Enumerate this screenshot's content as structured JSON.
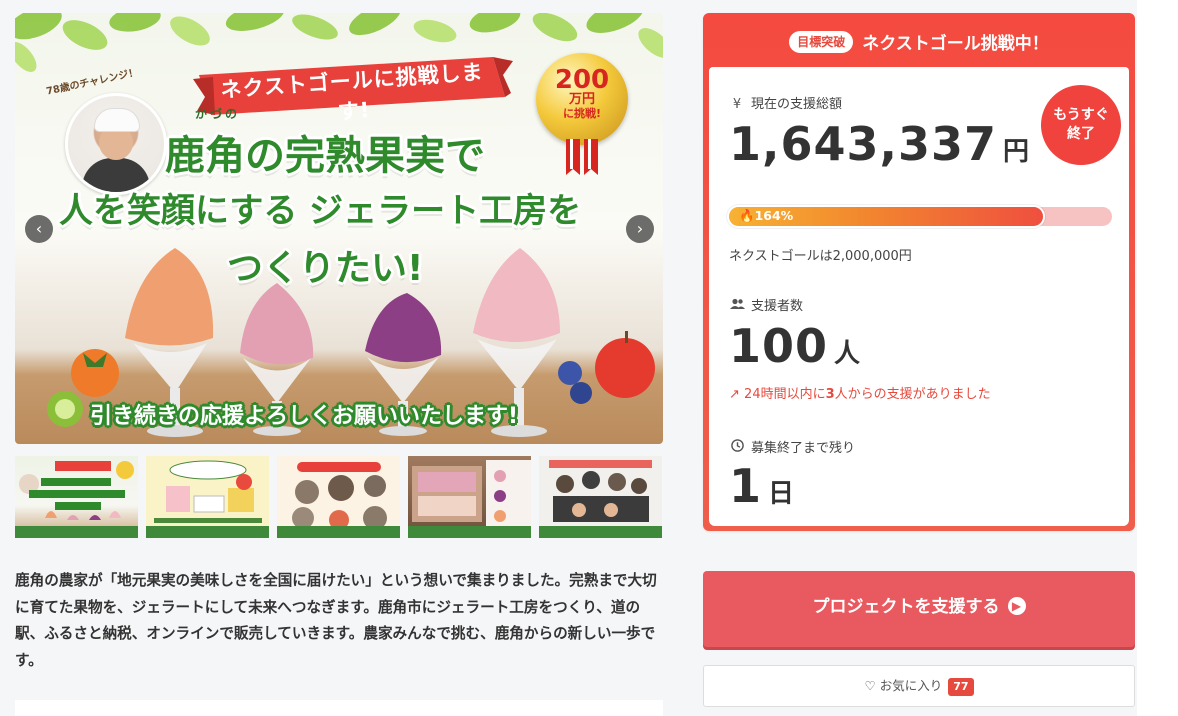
{
  "hero": {
    "banner": "ネクストゴールに挑戦します!",
    "badge_amount": "200",
    "badge_unit": "万円",
    "badge_challenge": "に挑戦!",
    "age_tag": "78歳のチャレンジ！",
    "furigana": "かづの",
    "title_line1": "鹿角の完熟果実で",
    "title_line2": "人を笑顔にする ジェラート工房を",
    "title_line3": "つくりたい!",
    "caption": "引き続きの応援よろしくお願いいたします!",
    "prev_icon": "chevron-left-icon",
    "next_icon": "chevron-right-icon"
  },
  "thumbnails": [
    {
      "name": "thumb-1"
    },
    {
      "name": "thumb-2"
    },
    {
      "name": "thumb-3"
    },
    {
      "name": "thumb-4"
    },
    {
      "name": "thumb-5"
    }
  ],
  "description": "鹿角の農家が「地元果実の美味しさを全国に届けたい」という想いで集まりました。完熟まで大切に育てた果物を、ジェラートにして未来へつなぎます。鹿角市にジェラート工房をつくり、道の駅、ふるさと納税、オンラインで販売していきます。農家みんなで挑む、鹿角からの新しい一歩です。",
  "stats": {
    "goal_badge": "目標突破",
    "goal_title": "ネクストゴール挑戦中！",
    "total_label": "現在の支援総額",
    "total_value": "1,643,337",
    "total_unit": "円",
    "soon_line1": "もうすぐ",
    "soon_line2": "終了",
    "progress_label": "164%",
    "progress_fraction": 0.82,
    "next_goal": "ネクストゴールは2,000,000円",
    "supporters_label": "支援者数",
    "supporters_value": "100",
    "supporters_unit": "人",
    "recent_prefix": "24時間以内に",
    "recent_count": "3",
    "recent_suffix": "人からの支援がありました",
    "remaining_label": "募集終了まで残り",
    "remaining_value": "1",
    "remaining_unit": "日"
  },
  "actions": {
    "support_button": "プロジェクトを支援する",
    "favorite_label": "お気に入り",
    "favorite_count": "77"
  },
  "colors": {
    "accent": "#e64a3e",
    "cta": "#e85a60",
    "title_green": "#2f8a2c"
  }
}
